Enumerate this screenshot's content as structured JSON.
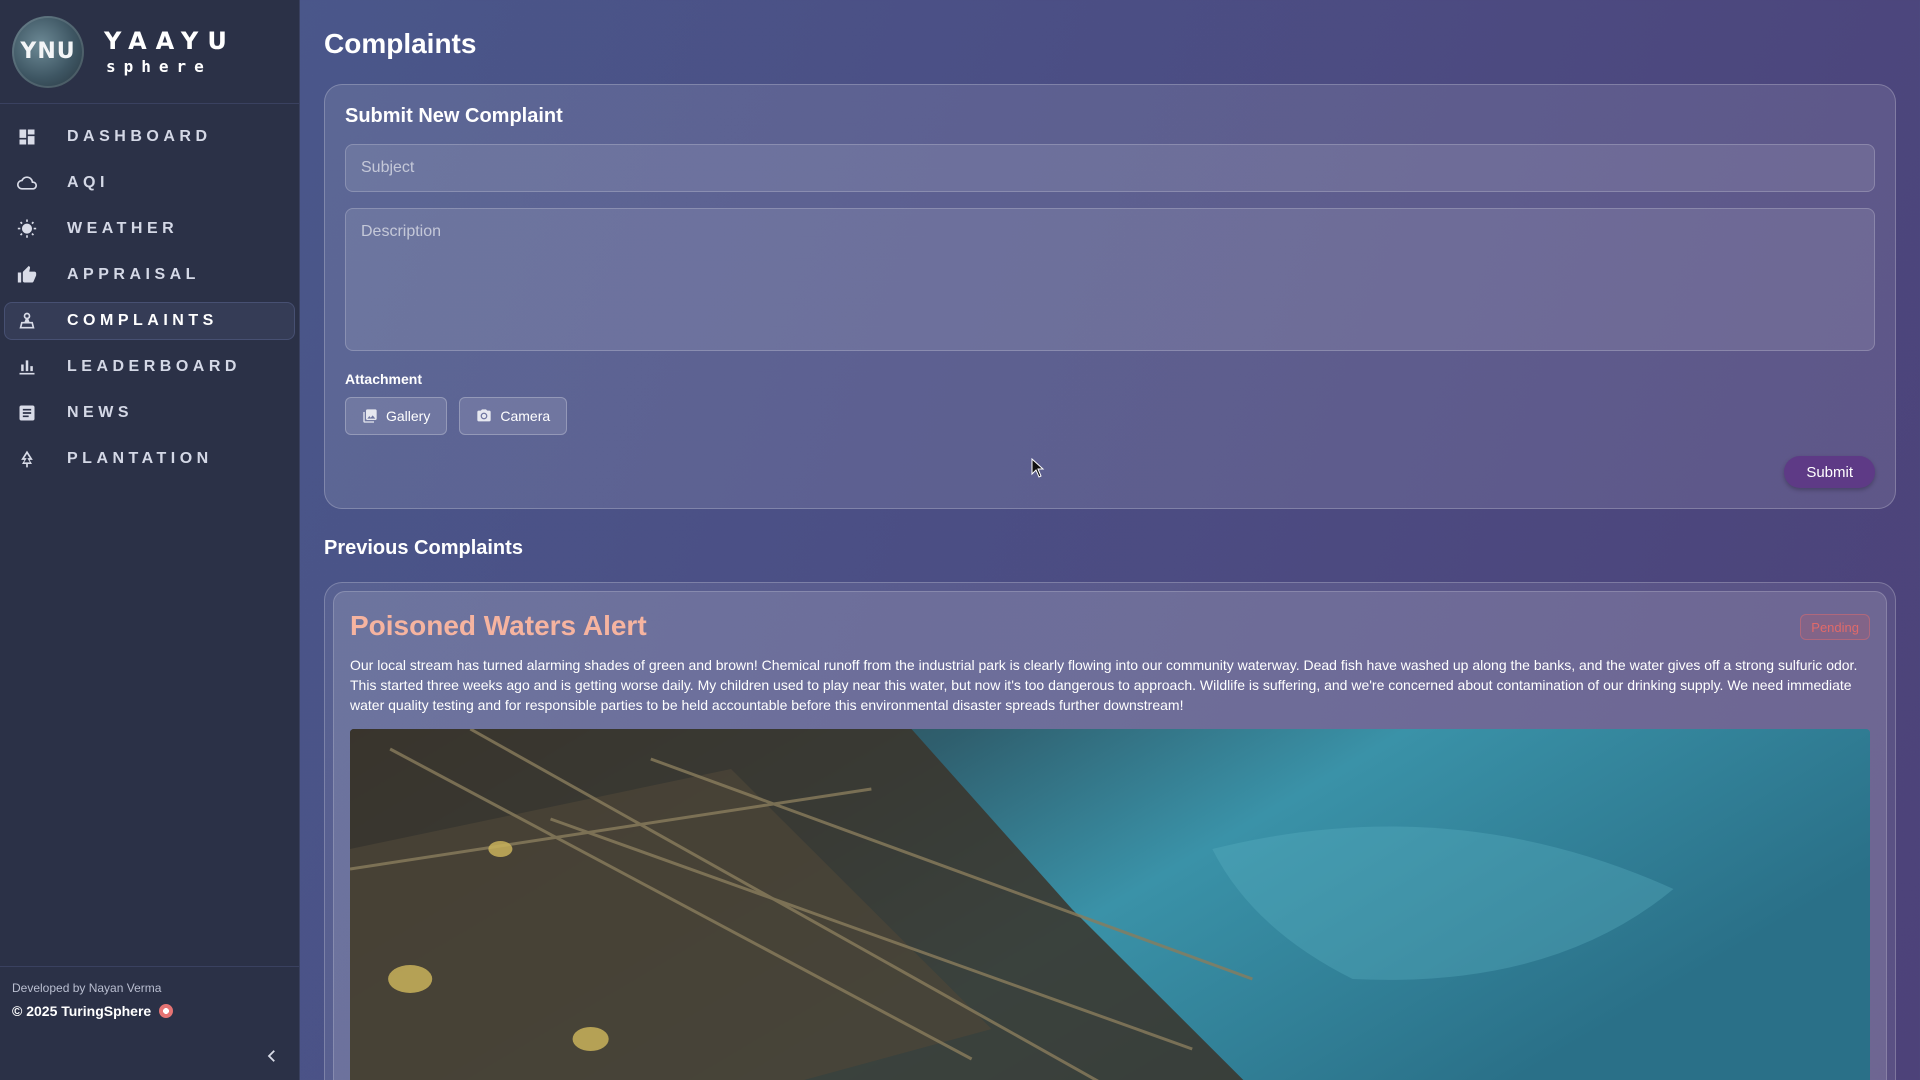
{
  "brand": {
    "logo_text": "YNU",
    "name": "YAAYU",
    "sub": "sphere"
  },
  "sidebar": {
    "items": [
      {
        "label": "DASHBOARD",
        "icon": "dashboard-icon",
        "active": false
      },
      {
        "label": "AQI",
        "icon": "cloud-icon",
        "active": false
      },
      {
        "label": "WEATHER",
        "icon": "sun-icon",
        "active": false
      },
      {
        "label": "APPRAISAL",
        "icon": "thumbs-up-icon",
        "active": false
      },
      {
        "label": "COMPLAINTS",
        "icon": "complaint-icon",
        "active": true
      },
      {
        "label": "LEADERBOARD",
        "icon": "bar-chart-icon",
        "active": false
      },
      {
        "label": "NEWS",
        "icon": "news-icon",
        "active": false
      },
      {
        "label": "PLANTATION",
        "icon": "tree-icon",
        "active": false
      }
    ],
    "footer": {
      "developer": "Developed by Nayan Verma",
      "copyright": "© 2025 TuringSphere"
    }
  },
  "page": {
    "title": "Complaints"
  },
  "form": {
    "title": "Submit New Complaint",
    "subject_placeholder": "Subject",
    "description_placeholder": "Description",
    "attachment_label": "Attachment",
    "gallery_label": "Gallery",
    "camera_label": "Camera",
    "submit_label": "Submit"
  },
  "previous": {
    "title": "Previous Complaints",
    "complaints": [
      {
        "title": "Poisoned Waters Alert",
        "status": "Pending",
        "description": "Our local stream has turned alarming shades of green and brown! Chemical runoff from the industrial park is clearly flowing into our community waterway. Dead fish have washed up along the banks, and the water gives off a strong sulfuric odor. This started three weeks ago and is getting worse daily. My children used to play near this water, but now it's too dangerous to approach. Wildlife is suffering, and we're concerned about contamination of our drinking supply. We need immediate water quality testing and for responsible parties to be held accountable before this environmental disaster spreads further downstream!"
      }
    ]
  },
  "colors": {
    "sidebar_bg": "#2b3147",
    "accent": "#5e3a86",
    "complaint_title": "#f6b4a0",
    "status_pending": "#e06a6a"
  }
}
